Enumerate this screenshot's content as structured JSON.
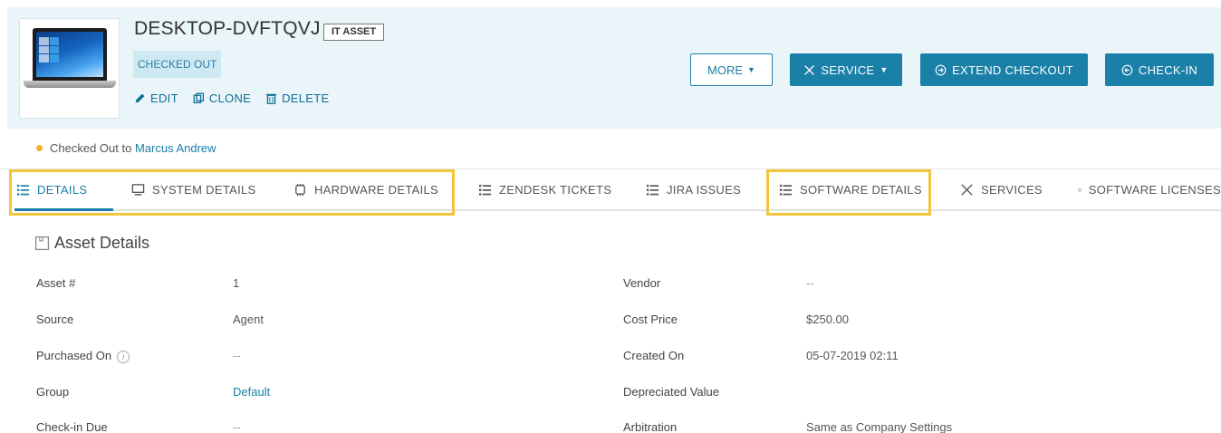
{
  "asset": {
    "name": "DESKTOP-DVFTQVJ",
    "type_badge": "IT ASSET",
    "status": "CHECKED OUT"
  },
  "asset_actions": {
    "edit": "EDIT",
    "clone": "CLONE",
    "delete": "DELETE"
  },
  "buttons": {
    "more": "MORE",
    "service": "SERVICE",
    "extend_checkout": "EXTEND CHECKOUT",
    "check_in": "CHECK-IN"
  },
  "checkout_info": {
    "prefix": "Checked Out to",
    "person": "Marcus Andrew"
  },
  "tabs": [
    {
      "label": "DETAILS",
      "icon": "list-icon",
      "active": true
    },
    {
      "label": "SYSTEM DETAILS",
      "icon": "monitor-icon"
    },
    {
      "label": "HARDWARE DETAILS",
      "icon": "chip-icon"
    },
    {
      "label": "ZENDESK TICKETS",
      "icon": "list-icon"
    },
    {
      "label": "JIRA ISSUES",
      "icon": "list-icon"
    },
    {
      "label": "SOFTWARE DETAILS",
      "icon": "list-icon"
    },
    {
      "label": "SERVICES",
      "icon": "tools-icon"
    },
    {
      "label": "SOFTWARE LICENSES",
      "icon": "license-icon"
    }
  ],
  "section": {
    "title": "Asset Details"
  },
  "details_left": [
    {
      "label": "Asset #",
      "value": "1"
    },
    {
      "label": "Source",
      "value": "Agent"
    },
    {
      "label": "Purchased On",
      "value": "--"
    },
    {
      "label": "Group",
      "value": "Default"
    },
    {
      "label": "Check-in Due",
      "value": "--"
    }
  ],
  "details_right": [
    {
      "label": "Vendor",
      "value": "--"
    },
    {
      "label": "Cost Price",
      "value": "$250.00"
    },
    {
      "label": "Created On",
      "value": "05-07-2019 02:11"
    },
    {
      "label": "Depreciated Value",
      "value": ""
    },
    {
      "label": "Arbitration",
      "value": "Same as Company Settings"
    }
  ],
  "colors": {
    "accent": "#1a80a8",
    "header_bg": "#eaf5f9",
    "highlight": "#f2c53d",
    "status_dot": "#f0b429"
  }
}
